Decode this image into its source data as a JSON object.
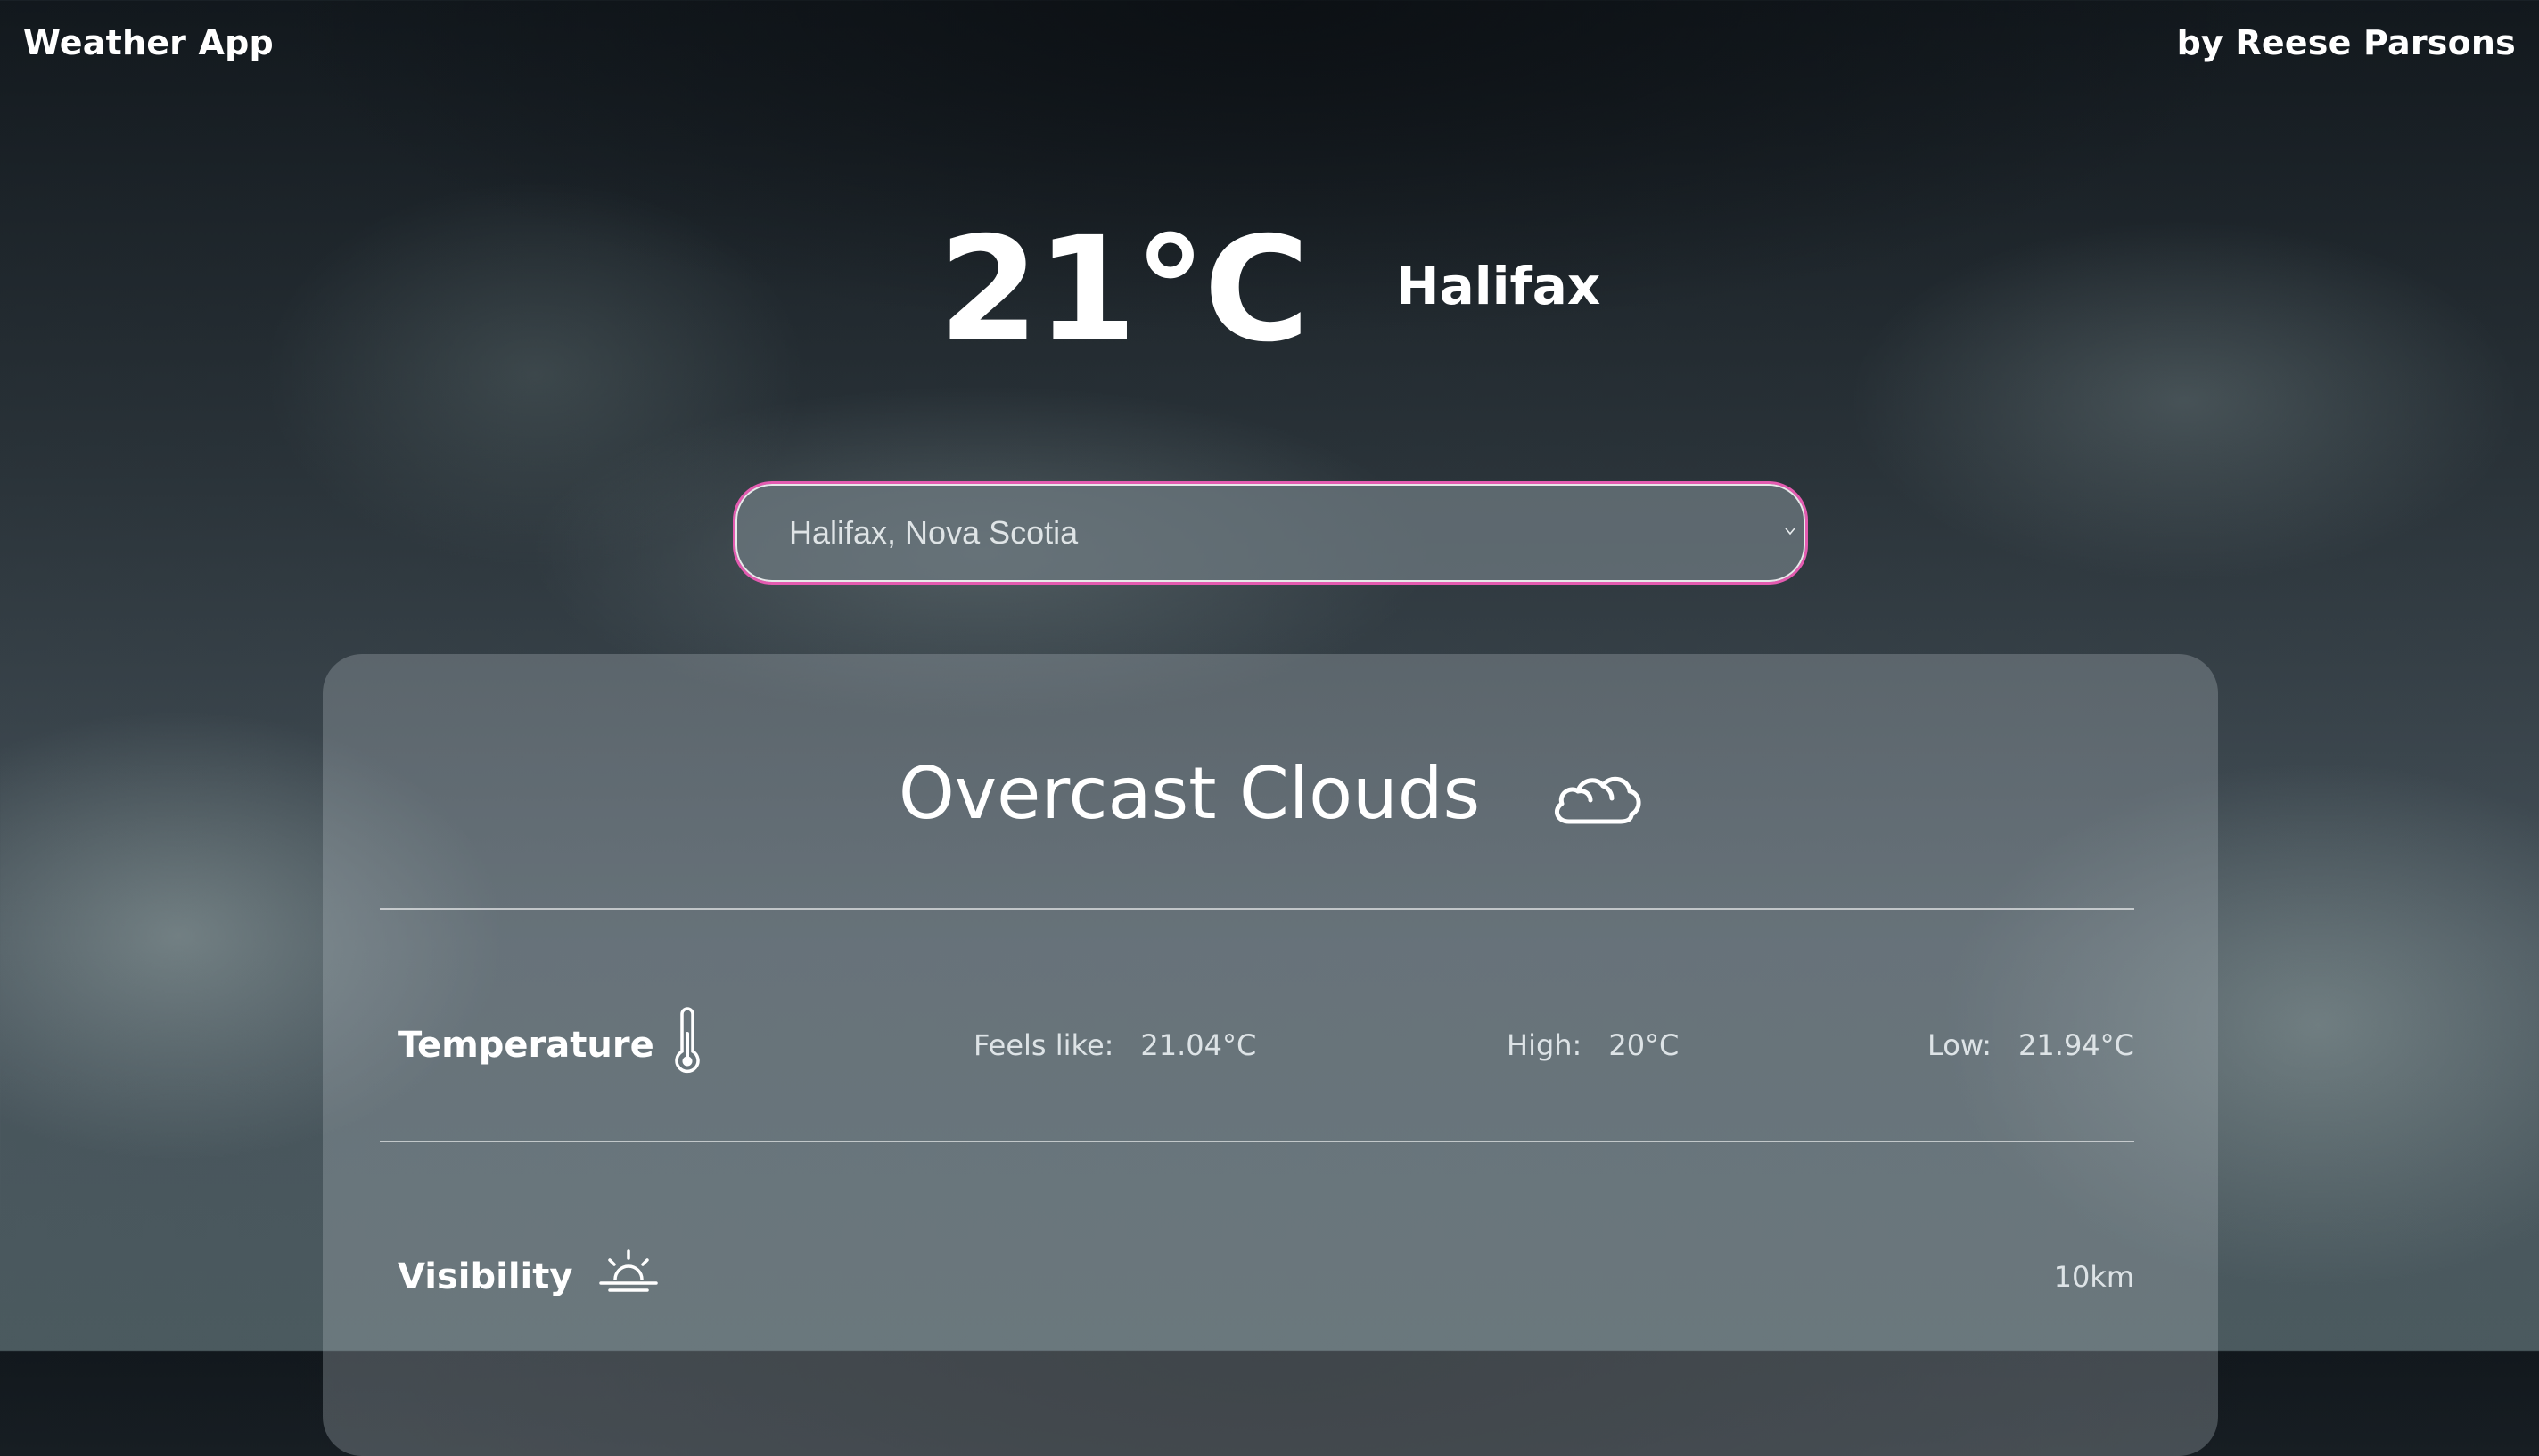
{
  "header": {
    "app_title": "Weather App",
    "author": "by Reese Parsons"
  },
  "hero": {
    "temperature": "21°C",
    "city": "Halifax"
  },
  "location_select": {
    "selected": "Halifax, Nova Scotia",
    "chevron_icon": "chevron-down-icon"
  },
  "condition": {
    "description": "Overcast Clouds",
    "icon": "cloud-icon"
  },
  "temperature_row": {
    "label": "Temperature",
    "icon": "thermometer-icon",
    "feels_like_label": "Feels like:",
    "feels_like_value": "21.04°C",
    "high_label": "High:",
    "high_value": "20°C",
    "low_label": "Low:",
    "low_value": "21.94°C"
  },
  "visibility_row": {
    "label": "Visibility",
    "icon": "sunrise-icon",
    "value": "10km"
  },
  "colors": {
    "select_border": "#e35bb0",
    "text": "#ffffff"
  }
}
